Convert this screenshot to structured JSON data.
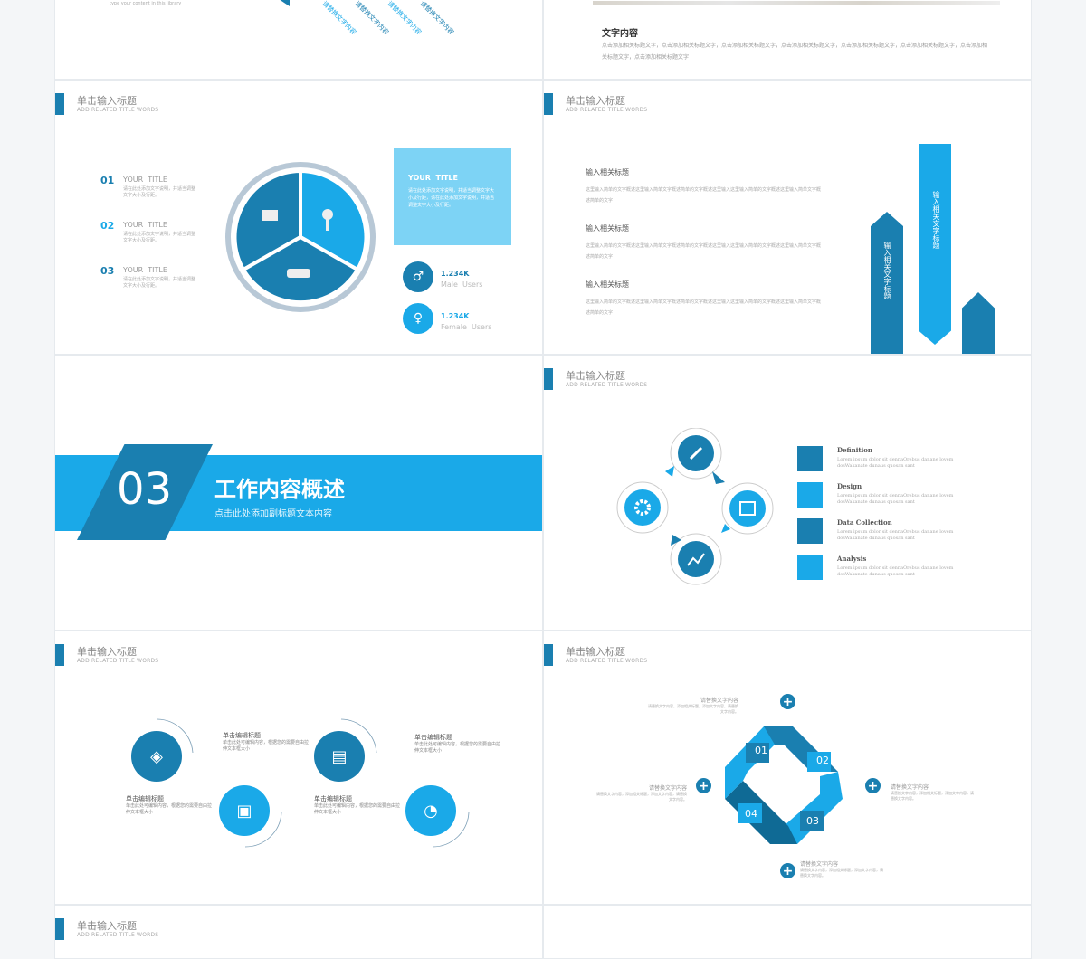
{
  "colors": {
    "dark": "#1a7fb0",
    "light": "#1aa9e8",
    "pale": "#7dd3f5",
    "text": "#666666"
  },
  "header": {
    "title": "单击输入标题",
    "subtitle": "ADD RELATED TITLE WORDS"
  },
  "slide_top_left": {
    "caption": "type your content in this library",
    "diag_labels": [
      "请替换文字内容",
      "请替换文字内容",
      "请替换文字内容",
      "请替换文字内容"
    ]
  },
  "slide_top_right": {
    "heading": "文字内容",
    "body": "点击添加相关标题文字，点击添加相关标题文字，点击添加相关标题文字，点击添加相关标题文字，点击添加相关标题文字，点击添加相关标题文字，点击添加相关标题文字，点击添加相关标题文字"
  },
  "slide_pie": {
    "items": [
      {
        "num": "01",
        "title": "YOUR  TITLE",
        "desc": "请在此处添加文字说明，并适当调整文字大小及行距。"
      },
      {
        "num": "02",
        "title": "YOUR  TITLE",
        "desc": "请在此处添加文字说明，并适当调整文字大小及行距。"
      },
      {
        "num": "03",
        "title": "YOUR  TITLE",
        "desc": "请在此处添加文字说明，并适当调整文字大小及行距。"
      }
    ],
    "box": {
      "title": "YOUR  TITLE",
      "desc": "请在此处添加文字说明，并适当调整文字大小及行距，请在此处添加文字说明，并适当调整文字大小及行距。"
    },
    "stats": [
      {
        "value": "1.234K",
        "label": "Male  Users",
        "icon": "male-icon"
      },
      {
        "value": "1.234K",
        "label": "Female  Users",
        "icon": "female-icon"
      }
    ]
  },
  "slide_arrows": {
    "items": [
      {
        "title": "输入相关标题",
        "desc": "这里输入简单的文字概述这里输入简单文字概述简单的文字概述这里输入这里输入简单的文字概述这里输入简单文字概述简单的文字"
      },
      {
        "title": "输入相关标题",
        "desc": "这里输入简单的文字概述这里输入简单文字概述简单的文字概述这里输入这里输入简单的文字概述这里输入简单文字概述简单的文字"
      },
      {
        "title": "输入相关标题",
        "desc": "这里输入简单的文字概述这里输入简单文字概述简单的文字概述这里输入这里输入简单的文字概述这里输入简单文字概述简单的文字"
      }
    ],
    "arrow_labels": [
      "输入相关文字标题",
      "输入相关文字标题"
    ]
  },
  "slide_section": {
    "number": "03",
    "title": "工作内容概述",
    "subtitle": "点击此处添加副标题文本内容"
  },
  "slide_cycle": {
    "icons": [
      "brush-icon",
      "calendar-icon",
      "chart-icon",
      "gear-icon"
    ],
    "legend": [
      {
        "title": "Definition",
        "desc": "Lorem ipsum dolor sit dennaOrebus danane lovem dosWakanate dunaus quosan sant"
      },
      {
        "title": "Design",
        "desc": "Lorem ipsum dolor sit dennaOrebus danane lovem dosWakanate dunaus quosan sant"
      },
      {
        "title": "Data Collection",
        "desc": "Lorem ipsum dolor sit dennaOrebus danane lovem dosWakanate dunaus quosan sant"
      },
      {
        "title": "Analysis",
        "desc": "Lorem ipsum dolor sit dennaOrebus danane lovem dosWakanate dunaus quosan sant"
      }
    ]
  },
  "slide_steps": {
    "items": [
      {
        "title": "单击编辑标题",
        "desc": "单击此处可编辑内容，根据您的需要自由拉伸文本框大小",
        "icon": "compass-icon"
      },
      {
        "title": "单击编辑标题",
        "desc": "单击此处可编辑内容，根据您的需要自由拉伸文本框大小",
        "icon": "wallet-icon"
      },
      {
        "title": "单击编辑标题",
        "desc": "单击此处可编辑内容，根据您的需要自由拉伸文本框大小",
        "icon": "message-icon"
      },
      {
        "title": "单击编辑标题",
        "desc": "单击此处可编辑内容，根据您的需要自由拉伸文本框大小",
        "icon": "pie-icon"
      }
    ]
  },
  "slide_loop": {
    "numbers": [
      "01",
      "02",
      "03",
      "04"
    ],
    "notes": [
      {
        "title": "请替换文字内容",
        "desc": "请替换文字内容，添加相关标题，添加文字内容，请替换文字内容。"
      },
      {
        "title": "请替换文字内容",
        "desc": "请替换文字内容，添加相关标题，添加文字内容，请替换文字内容。"
      },
      {
        "title": "请替换文字内容",
        "desc": "请替换文字内容，添加相关标题，添加文字内容，请替换文字内容。"
      },
      {
        "title": "请替换文字内容",
        "desc": "请替换文字内容，添加相关标题，添加文字内容，请替换文字内容。"
      }
    ]
  }
}
